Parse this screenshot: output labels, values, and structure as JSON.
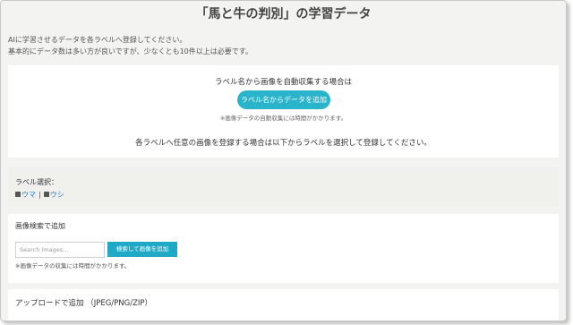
{
  "header": {
    "title": "「馬と牛の判別」の学習データ"
  },
  "intro": {
    "line1": "AIに学習させるデータを各ラベルへ登録してください。",
    "line2": "基本的にデータ数は多い方が良いですが、少なくとも10件以上は必要です。"
  },
  "auto_collect": {
    "heading": "ラベル名から画像を自動収集する場合は",
    "button_label": "ラベル名からデータを追加",
    "note": "※画像データの自動収集には時間がかかります。"
  },
  "manual": {
    "heading": "各ラベルへ任意の画像を登録する場合は以下からラベルを選択して登録してください。"
  },
  "label_select": {
    "title": "ラベル選択：",
    "labels": [
      "ウマ",
      "ウシ"
    ],
    "separator": "|",
    "tag_icon": "tag-icon"
  },
  "image_search": {
    "title": "画像検索で追加",
    "placeholder": "Search Images...",
    "value": "",
    "button_label": "検索して画像を追加",
    "note": "※画像データの収集には時間がかかります。"
  },
  "upload": {
    "title": "アップロードで追加 （JPEG/PNG/ZIP）"
  },
  "colors": {
    "accent": "#29b4cc",
    "search_button": "#1fa9c4",
    "link": "#2a7dc4",
    "panel_bg": "#f0f0ec"
  }
}
